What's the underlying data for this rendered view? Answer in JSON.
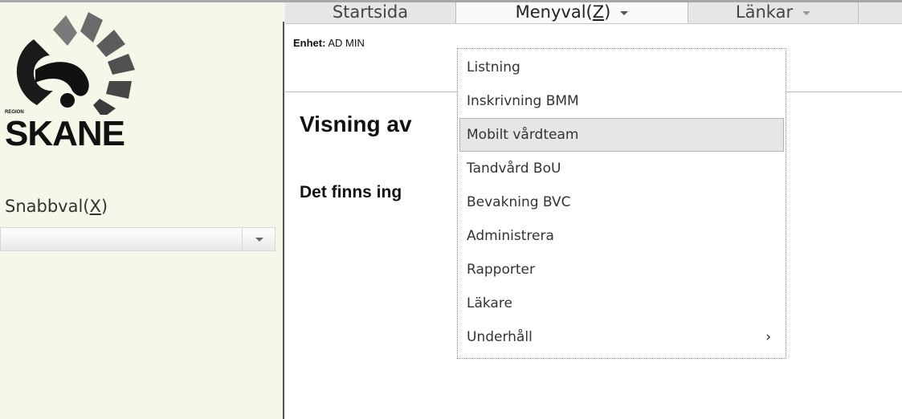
{
  "brand": {
    "region_text": "REGION",
    "name": "SKANE"
  },
  "sidebar": {
    "quick_label_prefix": "Snabbval(",
    "quick_label_hotkey": "X",
    "quick_label_suffix": ")",
    "quick_select_value": ""
  },
  "nav": {
    "items": [
      {
        "label": "Startsida"
      },
      {
        "label_prefix": "Menyval(",
        "hotkey": "Z",
        "label_suffix": ")"
      },
      {
        "label": "Länkar"
      }
    ]
  },
  "content": {
    "unit_label": "Enhet:",
    "unit_value": "AD MIN",
    "page_title": "Visning av",
    "empty_message": "Det finns ing"
  },
  "menu": {
    "items": [
      {
        "label": "Listning"
      },
      {
        "label": "Inskrivning BMM"
      },
      {
        "label": "Mobilt vårdteam"
      },
      {
        "label": "Tandvård BoU"
      },
      {
        "label": "Bevakning BVC"
      },
      {
        "label": "Administrera"
      },
      {
        "label": "Rapporter"
      },
      {
        "label": "Läkare"
      },
      {
        "label": "Underhåll",
        "submenu_glyph": "›"
      }
    ]
  },
  "icons": {
    "logo": "region-skane-logo",
    "dropdown_arrow": "chevron-down-icon",
    "submenu_arrow": "chevron-right-icon"
  }
}
